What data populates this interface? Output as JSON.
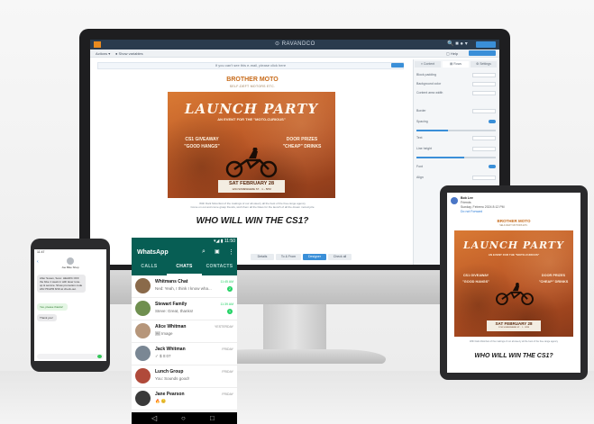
{
  "monitor": {
    "app_brand": "⊙ RAVANDCO",
    "header_icons": "🔍 ■ ● ▾",
    "header_button": "",
    "toolbar": {
      "left_a": "Actions ▾",
      "left_b": "● Show variables",
      "right_a": "▢ Help"
    },
    "notice": "If you can't see this e-mail, please click here",
    "brand_title": "BROTHER MOTO",
    "brand_sub": "SELF-DEFT MOTORS ETC.",
    "poster": {
      "title": "LAUNCH PARTY",
      "subtitle": "AN EVENT FOR THE \"MOTO-CURIOUS\"",
      "left_a": "CS1 GIVEAWAY",
      "left_b": "\"GOOD HANGS\"",
      "right_a": "DOOR PRIZES",
      "right_b": "\"CHEAP\" DRINKS",
      "date": "SAT FEBRUARY 28",
      "date_sub": "1234 SOMEWHERE ST. · 1 – 5PM"
    },
    "fineprint_a": "With Dark Motorfest of the makings of our all-steezy all the best of the free-range agency",
    "fineprint_b": "Come on out and come grasp friends, wish them all the bikes for the launch of all the dream motorcycle",
    "headline": "WHO WILL WIN THE CS1?",
    "panel": {
      "tabs": [
        "≡ Content",
        "▤ Rows",
        "⚙ Settings"
      ],
      "rows": [
        "Block padding",
        "Background color",
        "Content area width",
        "Border",
        "Spacing",
        "Text",
        "Line height",
        "Font",
        "Align"
      ]
    },
    "pills": [
      "Details",
      "To & From",
      "Designer",
      "Check all"
    ]
  },
  "sms_phone": {
    "status_time": "11:47",
    "contact": "Joe Bike Shop",
    "bubble_a": "After Susan, Soco: HEAD% OFF the bike 1 week in with laser tune-up & service. Show promotion code AM-Y5/APR 8/19 at check-out.",
    "bubble_b": "Yes, please thanks!",
    "bubble_c": "Thank you!"
  },
  "whatsapp": {
    "status_right": "▾◢ ▮ 11:50",
    "title": "WhatsApp",
    "icons": [
      "search-icon",
      "chat-icon",
      "more-icon"
    ],
    "icon_glyphs": {
      "search": "⌕",
      "chat": "▣",
      "more": "⋮"
    },
    "tabs": [
      "CALLS",
      "CHATS",
      "CONTACTS"
    ],
    "chats": [
      {
        "name": "Whitmans Chat",
        "message": "Ned: Yeah, I think I know wha...",
        "time": "11:45 AM",
        "badge": "2",
        "time_green": true,
        "avatar_color": "#8a6a4a"
      },
      {
        "name": "Stewart Family",
        "message": "Steve: Great, thanks!",
        "time": "11:39 AM",
        "badge": "1",
        "time_green": true,
        "avatar_color": "#6f8f4f"
      },
      {
        "name": "Alice Whitman",
        "message": "🖼 Image",
        "time": "YESTERDAY",
        "badge": "",
        "time_green": false,
        "avatar_color": "#b6967a"
      },
      {
        "name": "Jack Whitman",
        "message": "✓ $ 0:07",
        "time": "FRIDAY",
        "badge": "",
        "time_green": false,
        "avatar_color": "#7a8794"
      },
      {
        "name": "Lunch Group",
        "message": "You: Sounds good!",
        "time": "FRIDAY",
        "badge": "",
        "time_green": false,
        "avatar_color": "#b04a3a"
      },
      {
        "name": "Jane Pearson",
        "message": "🔥 😊",
        "time": "FRIDAY",
        "badge": "",
        "time_green": false,
        "avatar_color": "#3a3a3a"
      }
    ],
    "nav": [
      "◁",
      "○",
      "□"
    ]
  },
  "tablet": {
    "sender": "Bob Lee",
    "sender_line2": "Friends",
    "sender_line3": "Sunday, Febrero 2024 8:12 PM",
    "link": "Do not Forward",
    "brand_title": "BROTHER MOTO",
    "brand_sub": "SELF-DEFT MOTORS ETC.",
    "fineprint": "With Dark Motorfest of the makings of our all-steezy all the best of the free-range agency",
    "headline": "WHO WILL WIN THE CS1?"
  },
  "colors": {
    "whatsapp_green": "#075e54",
    "whatsapp_accent": "#25d366",
    "brand_orange": "#c86b1a",
    "ui_blue": "#3a8fd8"
  }
}
